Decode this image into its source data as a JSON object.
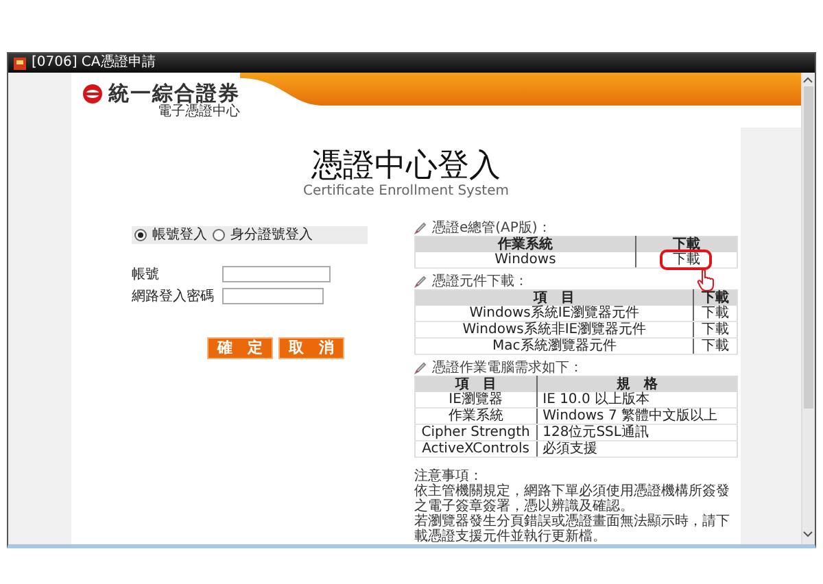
{
  "window": {
    "title": "[0706] CA憑證申請"
  },
  "header": {
    "company": "統一綜合證券",
    "department": "電子憑證中心"
  },
  "heading": {
    "title": "憑證中心登入",
    "subtitle": "Certificate Enrollment System"
  },
  "login": {
    "modes": [
      {
        "label": "帳號登入",
        "selected": true
      },
      {
        "label": "身分證號登入",
        "selected": false
      }
    ],
    "fields": [
      {
        "label": "帳號"
      },
      {
        "label": "網路登入密碼"
      }
    ],
    "buttons": [
      "確　定",
      "取　消"
    ]
  },
  "sections": [
    {
      "title": "憑證e總管(AP版)：",
      "kind": "download",
      "columns": [
        "作業系統",
        "下載"
      ],
      "rows": [
        {
          "cells": [
            "Windows",
            "下載"
          ],
          "circled": true
        }
      ]
    },
    {
      "title": "憑證元件下載：",
      "kind": "download",
      "columns": [
        "項　目",
        "下載"
      ],
      "rows": [
        {
          "cells": [
            "Windows系統IE瀏覽器元件",
            "下載"
          ],
          "circled": false
        },
        {
          "cells": [
            "Windows系統非IE瀏覽器元件",
            "下載"
          ],
          "circled": false
        },
        {
          "cells": [
            "Mac系統瀏覽器元件",
            "下載"
          ],
          "circled": false
        }
      ]
    },
    {
      "title": "憑證作業電腦需求如下：",
      "kind": "spec",
      "columns": [
        "項　目",
        "規　格"
      ],
      "rows": [
        {
          "cells": [
            "IE瀏覽器",
            "IE 10.0 以上版本"
          ],
          "circled": false
        },
        {
          "cells": [
            "作業系統",
            "Windows 7 繁體中文版以上"
          ],
          "circled": false
        },
        {
          "cells": [
            "Cipher Strength",
            "128位元SSL通訊"
          ],
          "circled": false
        },
        {
          "cells": [
            "ActiveXControls",
            "必須支援"
          ],
          "circled": false
        }
      ]
    }
  ],
  "notes": {
    "title": "注意事項：",
    "paragraphs": [
      "依主管機關規定，網路下單必須使用憑證機構所簽發之電子簽章簽署，憑以辨識及確認。",
      "若瀏覽器發生分頁錯誤或憑證畫面無法顯示時，請下載憑證支援元件並執行更新檔。"
    ]
  }
}
